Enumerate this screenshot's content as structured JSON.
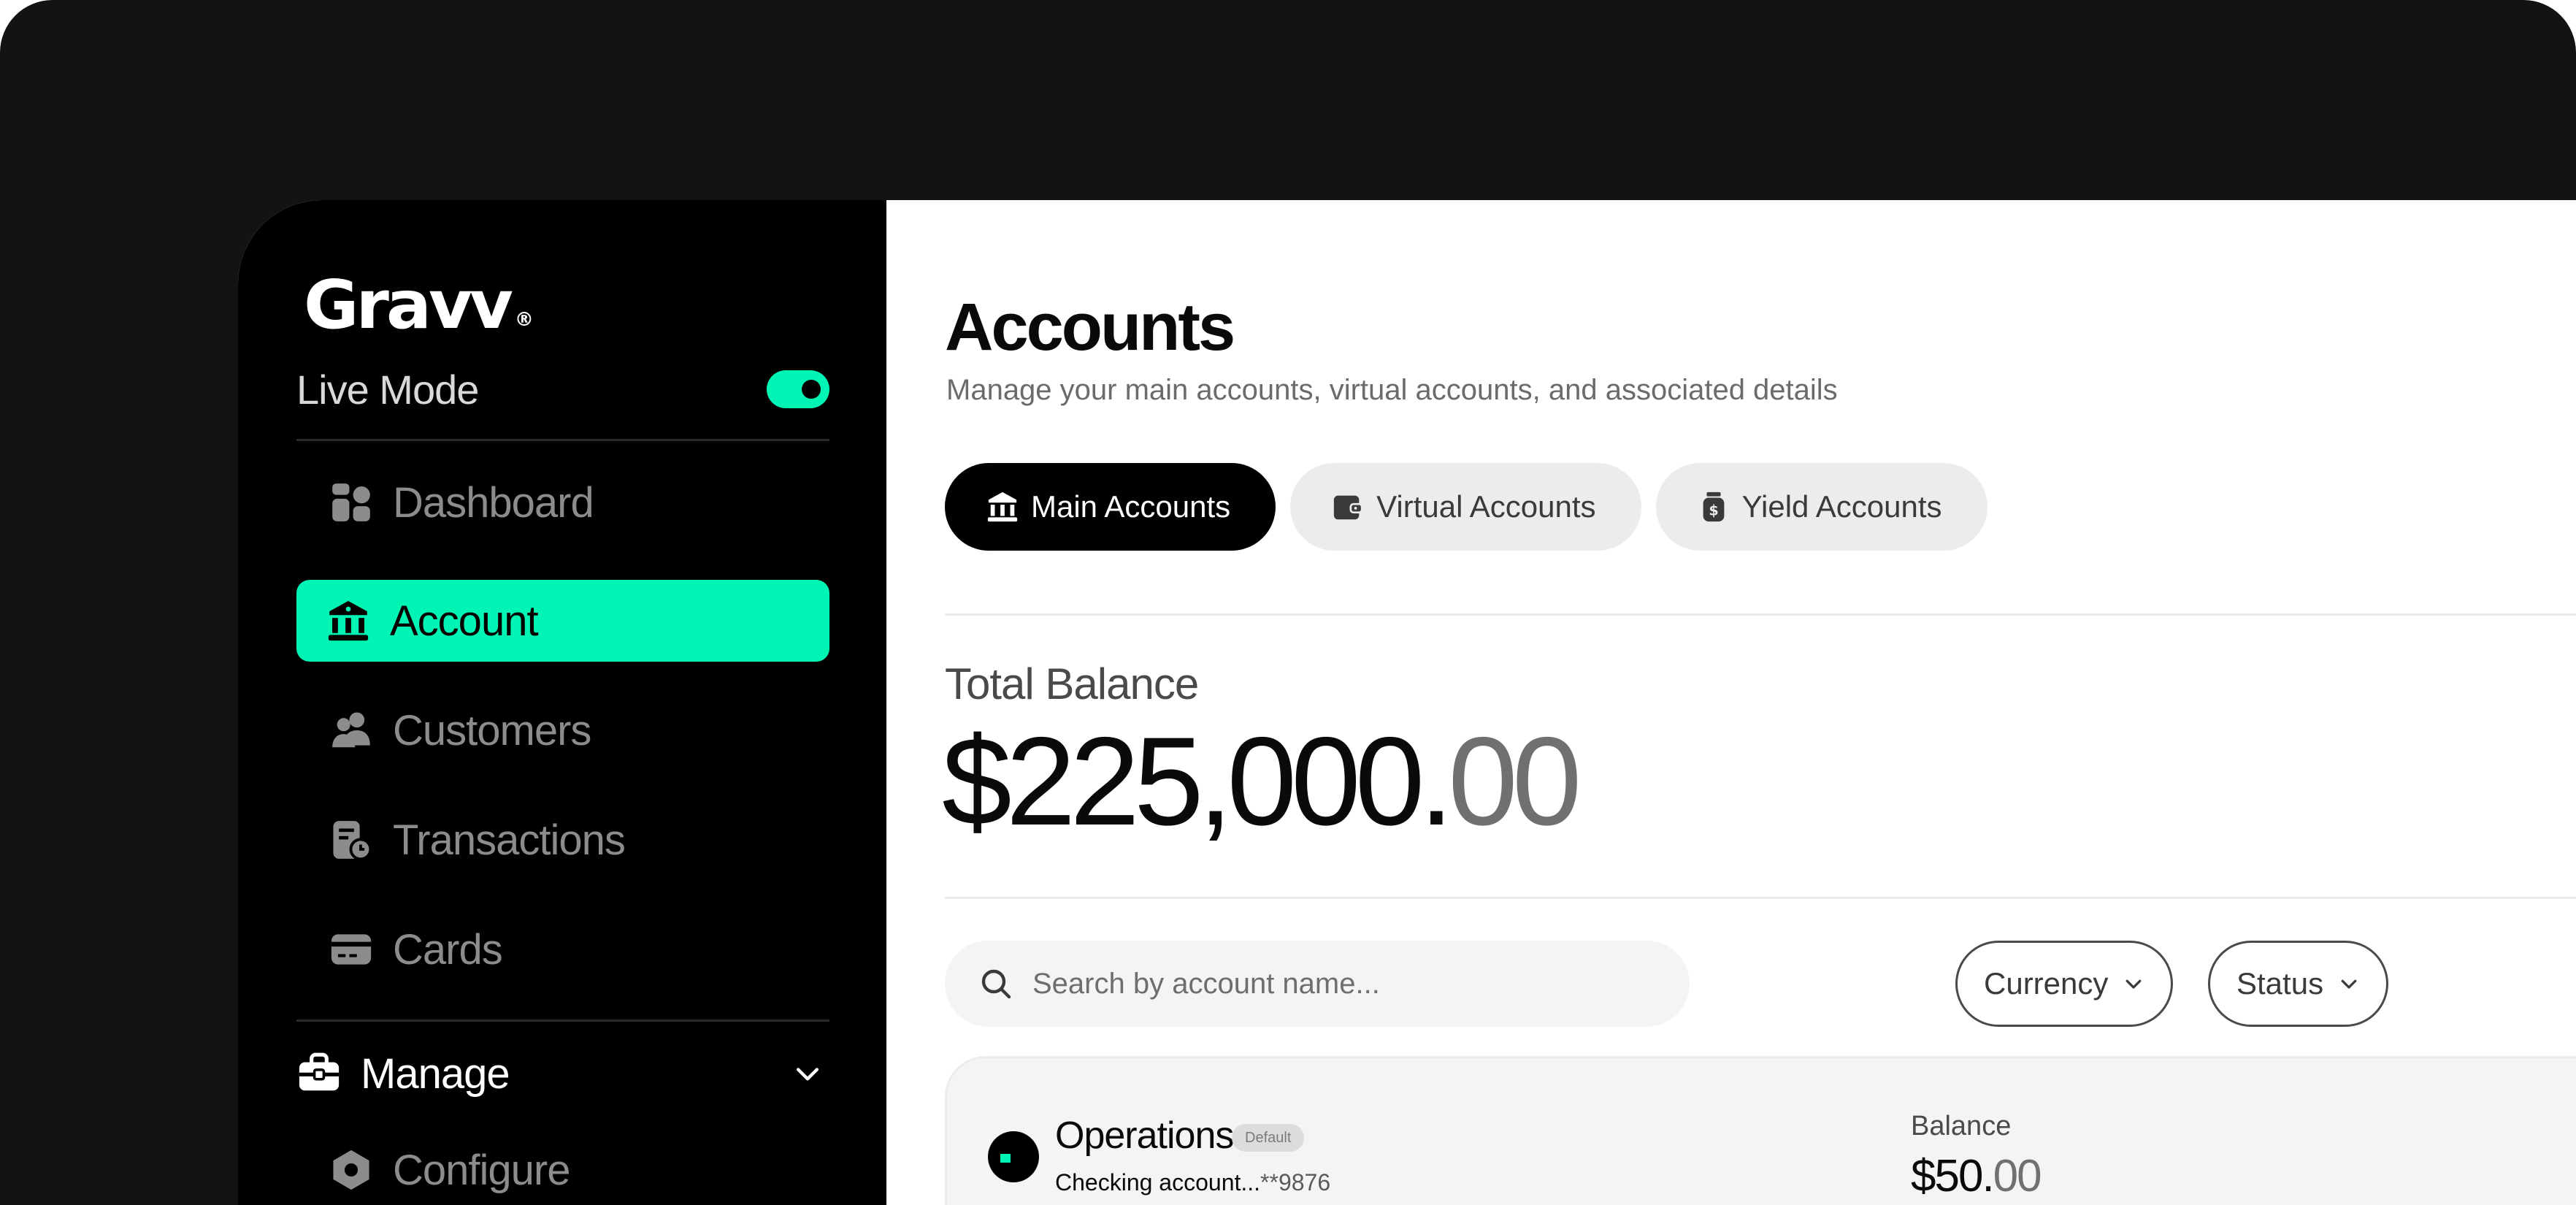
{
  "app": {
    "logo_text": "Gravv",
    "logo_mark": "®"
  },
  "sidebar": {
    "live_mode_label": "Live Mode",
    "live_mode_on": true,
    "items": [
      {
        "label": "Dashboard",
        "icon": "dashboard-icon",
        "active": false
      },
      {
        "label": "Account",
        "icon": "bank-icon",
        "active": true
      },
      {
        "label": "Customers",
        "icon": "users-icon",
        "active": false
      },
      {
        "label": "Transactions",
        "icon": "receipt-clock-icon",
        "active": false
      },
      {
        "label": "Cards",
        "icon": "card-icon",
        "active": false
      }
    ],
    "manage": {
      "label": "Manage",
      "icon": "briefcase-icon",
      "expanded": true
    },
    "sub_items": [
      {
        "label": "Configure",
        "icon": "hexagon-gear-icon"
      }
    ]
  },
  "main": {
    "title": "Accounts",
    "subtitle": "Manage your main accounts, virtual accounts, and associated details",
    "tabs": [
      {
        "label": "Main Accounts",
        "icon": "bank-icon",
        "active": true
      },
      {
        "label": "Virtual Accounts",
        "icon": "wallet-icon",
        "active": false
      },
      {
        "label": "Yield Accounts",
        "icon": "money-jar-icon",
        "active": false
      }
    ],
    "total_balance": {
      "label": "Total Balance",
      "whole": "$225,000.",
      "cents": "00"
    },
    "search": {
      "placeholder": "Search by account name..."
    },
    "filters": [
      {
        "label": "Currency"
      },
      {
        "label": "Status"
      }
    ],
    "accounts": [
      {
        "name": "Operations",
        "badge": "Default",
        "type": "Checking account...",
        "mask": "**9876",
        "balance_label": "Balance",
        "balance_whole": "$50.",
        "balance_cents": "00"
      }
    ]
  },
  "colors": {
    "accent": "#00f5b4",
    "sidebar_bg": "#000000",
    "frame_bg": "#131313"
  }
}
